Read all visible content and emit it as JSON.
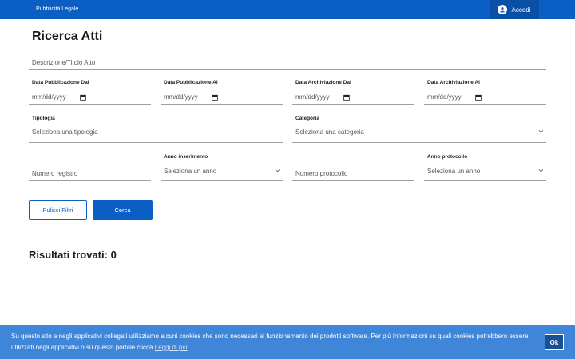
{
  "header": {
    "brand": "Pubblicità Legale",
    "login_label": "Accedi"
  },
  "page": {
    "title": "Ricerca Atti"
  },
  "filters": {
    "description": {
      "placeholder": "Descrizione/Titolo Atto"
    },
    "pub_from": {
      "label": "Data Pubblicazione Dal",
      "value": "mm/dd/yyyy"
    },
    "pub_to": {
      "label": "Data Pubblicazione Al",
      "value": "mm/dd/yyyy"
    },
    "arch_from": {
      "label": "Data Archiviazione Dal",
      "value": "mm/dd/yyyy"
    },
    "arch_to": {
      "label": "Data Archiviazione Al",
      "value": "mm/dd/yyyy"
    },
    "tipologia": {
      "label": "Tipologia",
      "value": "Seleziona una tipologia"
    },
    "categoria": {
      "label": "Categoria",
      "value": "Seleziona una categoria"
    },
    "numero_registro": {
      "placeholder": "Numero registro"
    },
    "anno_inserimento": {
      "label": "Anno inserimento",
      "value": "Seleziona un anno"
    },
    "numero_protocollo": {
      "placeholder": "Numero protocollo"
    },
    "anno_protocollo": {
      "label": "Anno protocollo",
      "value": "Seleziona un anno"
    }
  },
  "actions": {
    "clear_label": "Pulisci Filtri",
    "search_label": "Cerca"
  },
  "results": {
    "text": "Risultati trovati: 0"
  },
  "cookie": {
    "text": "Su questo sito e negli applicativi collegati utilizziamo alcuni cookies che sono necessari al funzionamento dei prodotti software. Per più informazioni su quali cookies potrebbero essere utilizzati negli applicativi o su questo portale clicca",
    "more_label": "Leggi di più",
    "ok_label": "Ok"
  },
  "colors": {
    "primary": "#0b5ec4",
    "cookie_bar": "#3f85d8"
  }
}
